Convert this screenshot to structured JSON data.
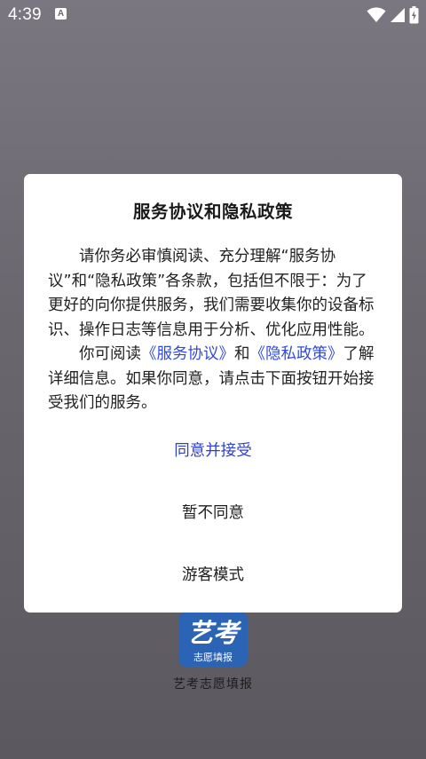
{
  "status_bar": {
    "time": "4:39",
    "notification_icon_letter": "A",
    "icons": [
      "wifi-icon",
      "cellular-signal-icon",
      "battery-icon"
    ]
  },
  "app": {
    "name": "艺考志愿填报",
    "logo": {
      "main_text": "艺考",
      "sub_text": "志愿填报",
      "color": "#2b63b5"
    }
  },
  "dialog": {
    "title": "服务协议和隐私政策",
    "paragraph1": "请你务必审慎阅读、充分理解“服务协议”和“隐私政策”各条款，包括但不限于：为了更好的向你提供服务，我们需要收集你的设备标识、操作日志等信息用于分析、优化应用性能。",
    "paragraph2": {
      "prefix": "你可阅读",
      "link1": "《服务协议》",
      "middle": "和",
      "link2": "《隐私政策》",
      "suffix": "了解详细信息。如果你同意，请点击下面按钮开始接受我们的服务。"
    },
    "buttons": {
      "accept": "同意并接受",
      "decline": "暂不同意",
      "guest": "游客模式"
    },
    "colors": {
      "link": "#2f4bd8",
      "accept": "#2f3fd0"
    }
  }
}
